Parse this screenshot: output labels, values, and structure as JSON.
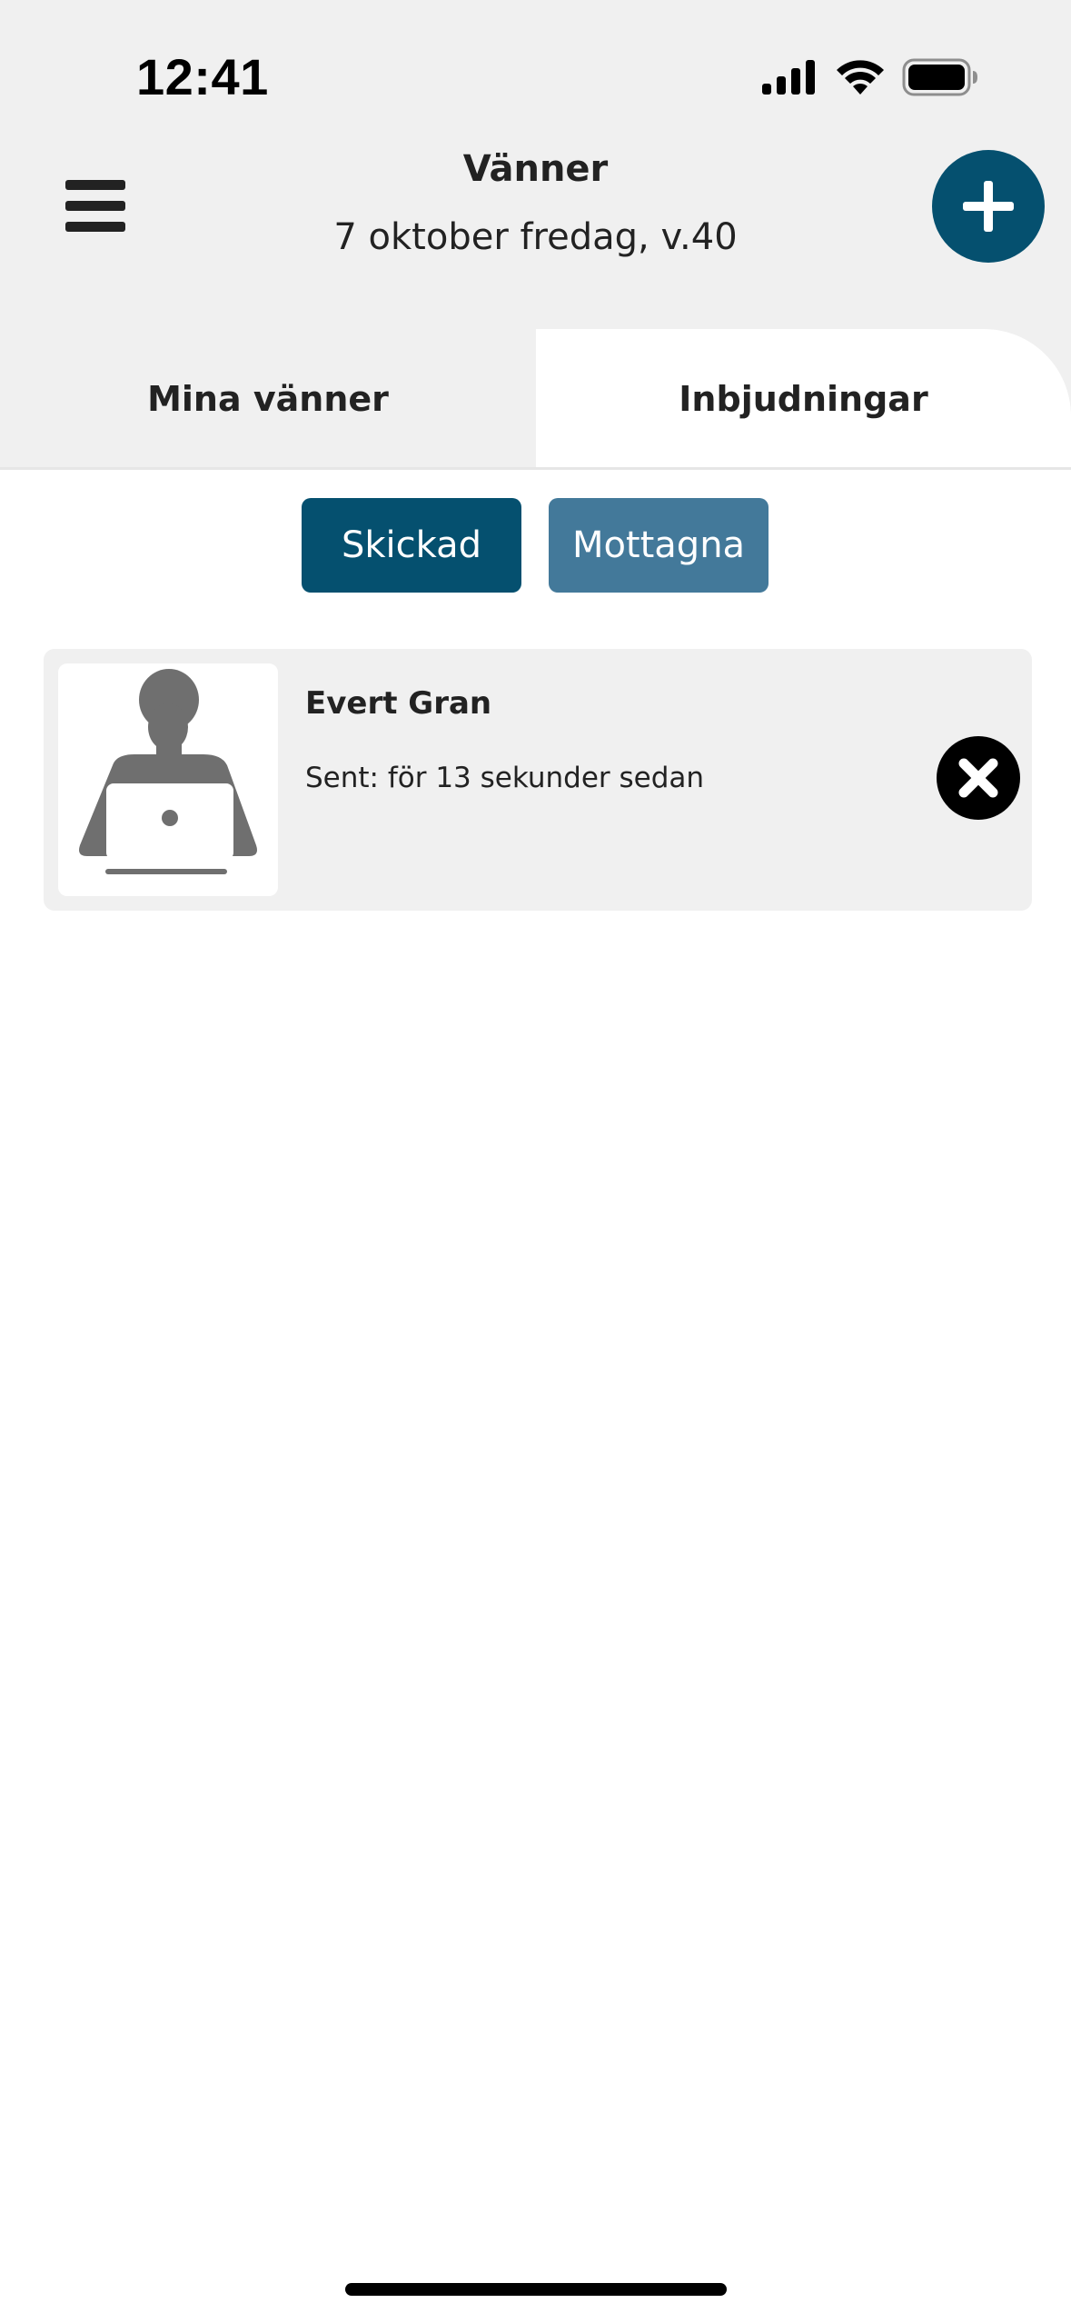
{
  "status_bar": {
    "time": "12:41",
    "icons": [
      "cellular-signal-icon",
      "wifi-icon",
      "battery-icon"
    ]
  },
  "header": {
    "menu_icon": "hamburger-menu-icon",
    "title": "Vänner",
    "subtitle": "7 oktober fredag, v.40",
    "add_icon": "plus-icon"
  },
  "tabs": [
    {
      "label": "Mina vänner",
      "active": false
    },
    {
      "label": "Inbjudningar",
      "active": true
    }
  ],
  "filter": {
    "sent_label": "Skickad",
    "received_label": "Mottagna",
    "selected": "Skickad"
  },
  "invites": [
    {
      "name": "Evert Gran",
      "status": "Sent: för 13 sekunder sedan",
      "avatar_icon": "person-with-laptop-avatar-icon",
      "action_icon": "close-icon"
    }
  ],
  "colors": {
    "primary": "#05506f",
    "secondary": "#43799a",
    "header_background": "#f0f0f0",
    "card_background": "#f0f0f0",
    "text": "#222222"
  }
}
